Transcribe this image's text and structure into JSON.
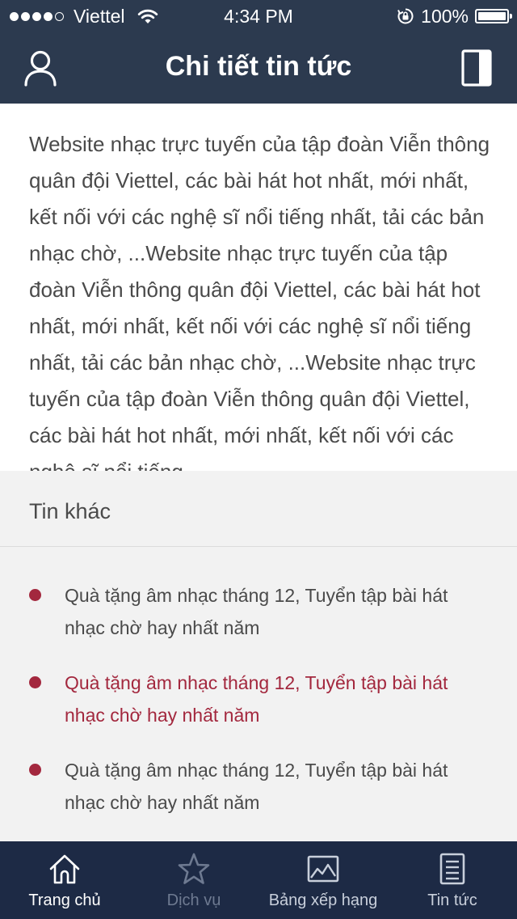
{
  "status_bar": {
    "carrier": "Viettel",
    "time": "4:34 PM",
    "battery": "100%",
    "signal_bars_filled": 4,
    "signal_bars_total": 5,
    "icons": [
      "wifi-icon",
      "orientation-lock-icon",
      "battery-icon"
    ]
  },
  "header": {
    "title": "Chi tiết tin tức",
    "left_icon": "user-icon",
    "right_icon": "bookmark-icon",
    "background_color": "#2c3a4f"
  },
  "article": {
    "body": "Website nhạc trực tuyến của tập đoàn Viễn thông quân đội Viettel, các bài hát hot nhất, mới nhất, kết nối với các nghệ sĩ nổi tiếng nhất, tải các bản nhạc chờ, ...Website nhạc trực tuyến của tập đoàn Viễn thông quân đội Viettel, các bài hát hot nhất, mới nhất, kết nối với các nghệ sĩ nổi tiếng nhất, tải các bản nhạc chờ, ...Website nhạc trực tuyến của tập đoàn Viễn thông quân đội Viettel, các bài hát hot nhất, mới nhất, kết nối với các nghệ sĩ nổi tiếng ."
  },
  "other_news": {
    "title": "Tin khác",
    "items": [
      {
        "text": "Quà tặng âm nhạc tháng 12, Tuyển tập bài hát nhạc chờ hay nhất năm",
        "highlighted": false
      },
      {
        "text": "Quà tặng âm nhạc tháng 12, Tuyển tập bài hát nhạc chờ hay nhất năm",
        "highlighted": true
      },
      {
        "text": "Quà tặng âm nhạc tháng 12, Tuyển tập bài hát nhạc chờ hay nhất năm",
        "highlighted": false
      }
    ],
    "bullet_color": "#a3283e",
    "highlight_color": "#a3283e"
  },
  "tab_bar": {
    "background_color": "#1d2a45",
    "tabs": [
      {
        "label": "Trang chủ",
        "icon": "home-icon",
        "state": "active"
      },
      {
        "label": "Dịch vụ",
        "icon": "star-icon",
        "state": "muted"
      },
      {
        "label": "Bảng xếp hạng",
        "icon": "chart-image-icon",
        "state": "normal"
      },
      {
        "label": "Tin tức",
        "icon": "news-document-icon",
        "state": "normal"
      }
    ]
  }
}
